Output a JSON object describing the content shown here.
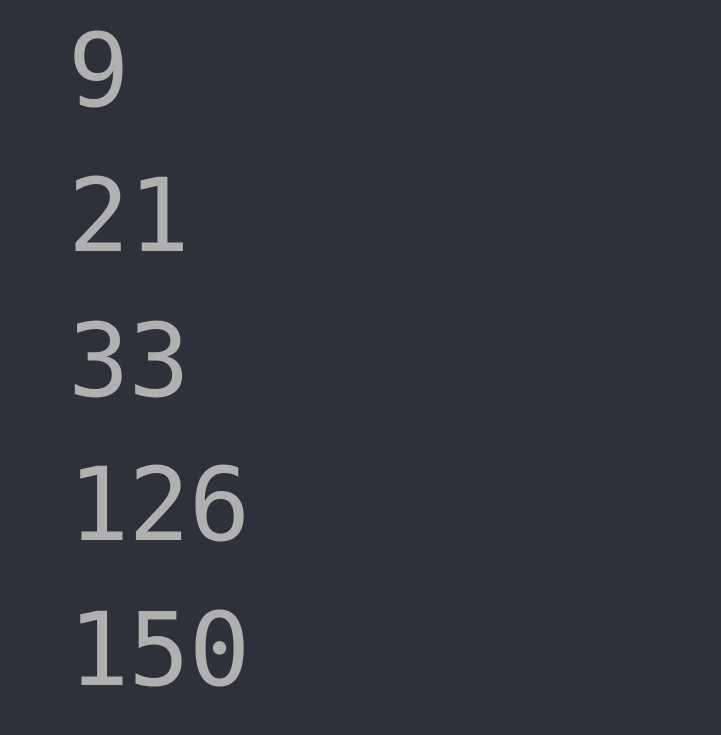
{
  "terminal": {
    "lines": [
      "9",
      "21",
      "33",
      "126",
      "150"
    ]
  }
}
